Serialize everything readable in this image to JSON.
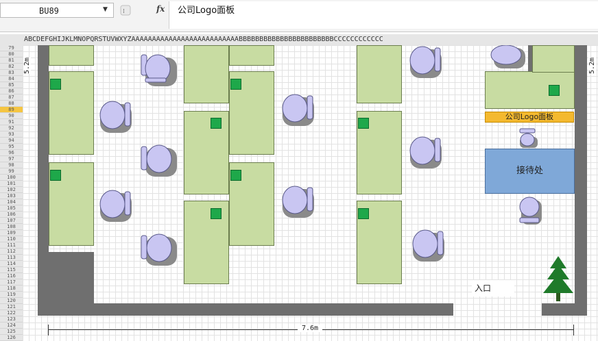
{
  "formula_bar": {
    "cell_reference": "BU89",
    "fx_label": "fx",
    "formula": "公司Logo面板"
  },
  "sheet": {
    "column_header_text": "ABCDEFGHIJKLMNOPQRSTUVWXYZAAAAAAAAAAAAAAAAAAAAAAAAAABBBBBBBBBBBBBBBBBBBBBBBCCCCCCCCCCCC",
    "row_numbers": [
      "79",
      "80",
      "81",
      "82",
      "83",
      "84",
      "85",
      "86",
      "87",
      "88",
      "89",
      "90",
      "91",
      "92",
      "93",
      "94",
      "95",
      "96",
      "97",
      "98",
      "99",
      "100",
      "101",
      "102",
      "103",
      "104",
      "105",
      "106",
      "107",
      "108",
      "109",
      "110",
      "111",
      "112",
      "113",
      "114",
      "115",
      "116",
      "117",
      "118",
      "119",
      "120",
      "121",
      "122",
      "123",
      "124",
      "125",
      "126"
    ],
    "selected_row": "89"
  },
  "floor_plan": {
    "logo_panel_label": "公司Logo面板",
    "reception_label": "接待处",
    "entrance_label": "入口",
    "dimension_left": "5.2m",
    "dimension_right": "5.2m",
    "dimension_bottom": "7.6m",
    "colors": {
      "wall": "#6f6f6f",
      "desk": "#c8dca2",
      "computer": "#1ea84a",
      "chair": "#c9c6f2",
      "logo_panel": "#f4b92f",
      "reception": "#7fa8d8",
      "tree": "#1f7a2a"
    }
  }
}
